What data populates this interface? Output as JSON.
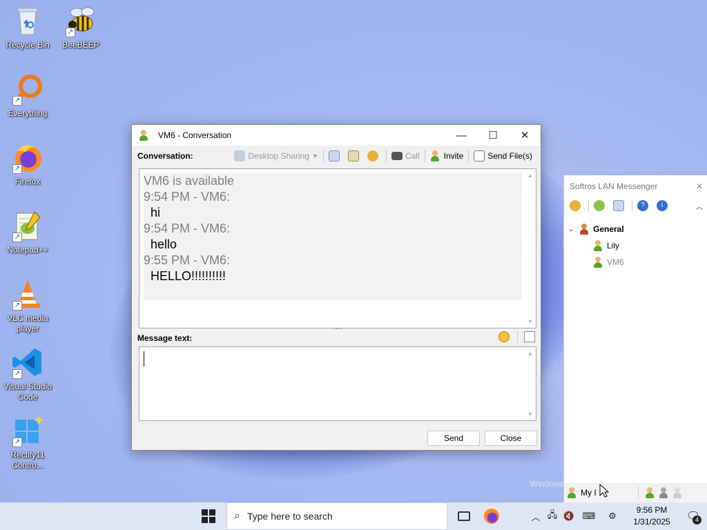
{
  "desktop": {
    "icons": [
      {
        "label": "Recycle Bin"
      },
      {
        "label": "BeeBEEP"
      },
      {
        "label": "Everything"
      },
      {
        "label": "Firefox"
      },
      {
        "label": "Notepad++"
      },
      {
        "label": "VLC media player"
      },
      {
        "label": "Visual Studio Code"
      },
      {
        "label": "Rectify11 Contro..."
      }
    ],
    "watermark": "Windows"
  },
  "conversation": {
    "title": "VM6 - Conversation",
    "label": "Conversation:",
    "toolbar": {
      "desktop_sharing": "Desktop Sharing",
      "call": "Call",
      "invite": "Invite",
      "send_files": "Send File(s)"
    },
    "messages": [
      {
        "type": "sys",
        "text": "VM6 is available"
      },
      {
        "type": "sys",
        "text": "9:54 PM - VM6:"
      },
      {
        "type": "msg",
        "text": "hi"
      },
      {
        "type": "sys",
        "text": "9:54 PM - VM6:"
      },
      {
        "type": "msg",
        "text": "hello"
      },
      {
        "type": "sys",
        "text": "9:55 PM - VM6:"
      },
      {
        "type": "msg",
        "text": "HELLO!!!!!!!!!!"
      }
    ],
    "message_label": "Message text:",
    "message_value": "",
    "send": "Send",
    "close": "Close"
  },
  "messenger": {
    "title": "Softros LAN Messenger",
    "group": "General",
    "users": [
      {
        "name": "Lily",
        "status": "online"
      },
      {
        "name": "VM6",
        "status": "dim"
      }
    ],
    "my_status": "My I"
  },
  "taskbar": {
    "search_placeholder": "Type here to search",
    "time": "9:56 PM",
    "date": "1/31/2025",
    "notification_count": "4"
  },
  "colors": {
    "accent": "#3446c9",
    "online_user": "#000000",
    "dim_user": "#8a8a8a"
  }
}
